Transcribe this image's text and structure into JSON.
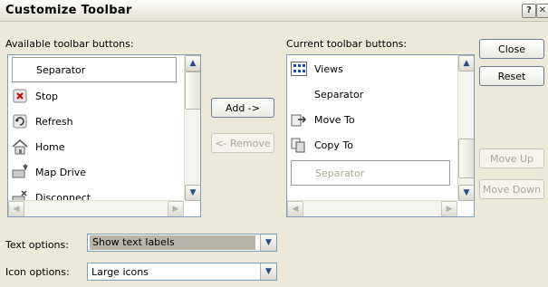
{
  "window": {
    "title": "Customize Toolbar",
    "help_glyph": "?",
    "close_glyph": "✕"
  },
  "available": {
    "label": "Available toolbar buttons:",
    "items": [
      {
        "label": "Separator",
        "icon": "none"
      },
      {
        "label": "Stop",
        "icon": "stop-icon"
      },
      {
        "label": "Refresh",
        "icon": "refresh-icon"
      },
      {
        "label": "Home",
        "icon": "home-icon"
      },
      {
        "label": "Map Drive",
        "icon": "map-drive-icon"
      },
      {
        "label": "Disconnect",
        "icon": "disconnect-icon"
      }
    ]
  },
  "current": {
    "label": "Current toolbar buttons:",
    "items": [
      {
        "label": "Views",
        "icon": "views-icon"
      },
      {
        "label": "Separator",
        "icon": "none"
      },
      {
        "label": "Move To",
        "icon": "move-to-icon"
      },
      {
        "label": "Copy To",
        "icon": "copy-to-icon"
      },
      {
        "label": "Separator",
        "icon": "none"
      }
    ]
  },
  "buttons": {
    "add": "Add ->",
    "remove": "<- Remove",
    "close": "Close",
    "reset": "Reset",
    "move_up": "Move Up",
    "move_down": "Move Down"
  },
  "options": {
    "text_label": "Text options:",
    "text_value": "Show text labels",
    "icon_label": "Icon options:",
    "icon_value": "Large icons"
  }
}
